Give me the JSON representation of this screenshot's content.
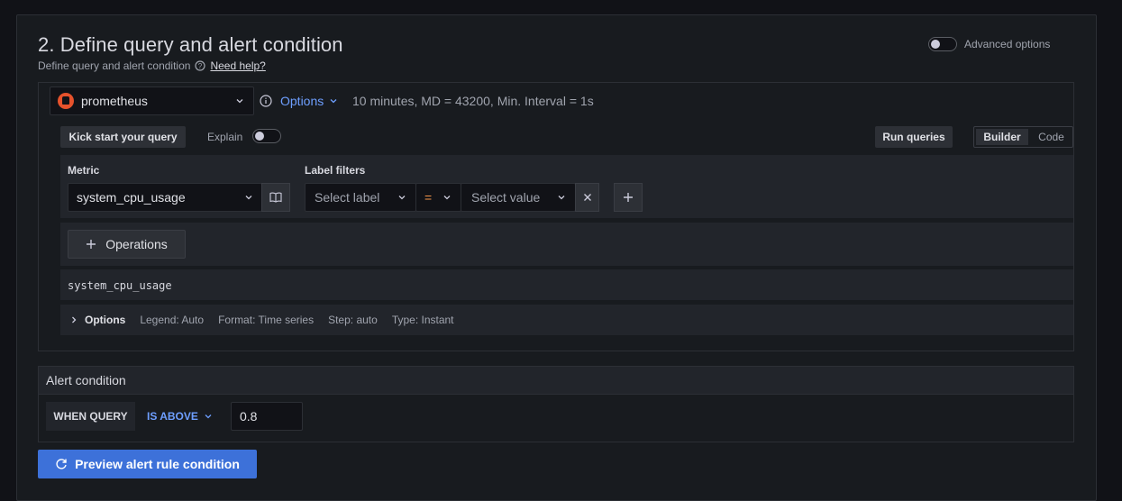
{
  "section": {
    "title": "2. Define query and alert condition",
    "subtitle": "Define query and alert condition",
    "help_link": "Need help?",
    "advanced_options_label": "Advanced options"
  },
  "query": {
    "datasource": "prometheus",
    "options_label": "Options",
    "options_summary": "10 minutes, MD = 43200, Min. Interval = 1s",
    "kickstart_label": "Kick start your query",
    "explain_label": "Explain",
    "run_queries_label": "Run queries",
    "mode_tabs": [
      "Builder",
      "Code"
    ],
    "active_mode": "Builder",
    "metric_label": "Metric",
    "metric_value": "system_cpu_usage",
    "label_filters_label": "Label filters",
    "select_label_placeholder": "Select label",
    "operator": "=",
    "select_value_placeholder": "Select value",
    "operations_label": "Operations",
    "raw_query": "system_cpu_usage",
    "options_row": {
      "label": "Options",
      "legend": "Legend: Auto",
      "format": "Format: Time series",
      "step": "Step: auto",
      "type": "Type: Instant"
    }
  },
  "alert_condition": {
    "title": "Alert condition",
    "when_query": "WHEN QUERY",
    "operator": "IS ABOVE",
    "threshold": "0.8"
  },
  "preview_button": "Preview alert rule condition",
  "colors": {
    "background": "#111217",
    "panel": "#181b1f",
    "accent": "#3d71d9",
    "link_blue": "#6e9fff",
    "prometheus": "#e6522c",
    "operator_orange": "#f5954a"
  }
}
